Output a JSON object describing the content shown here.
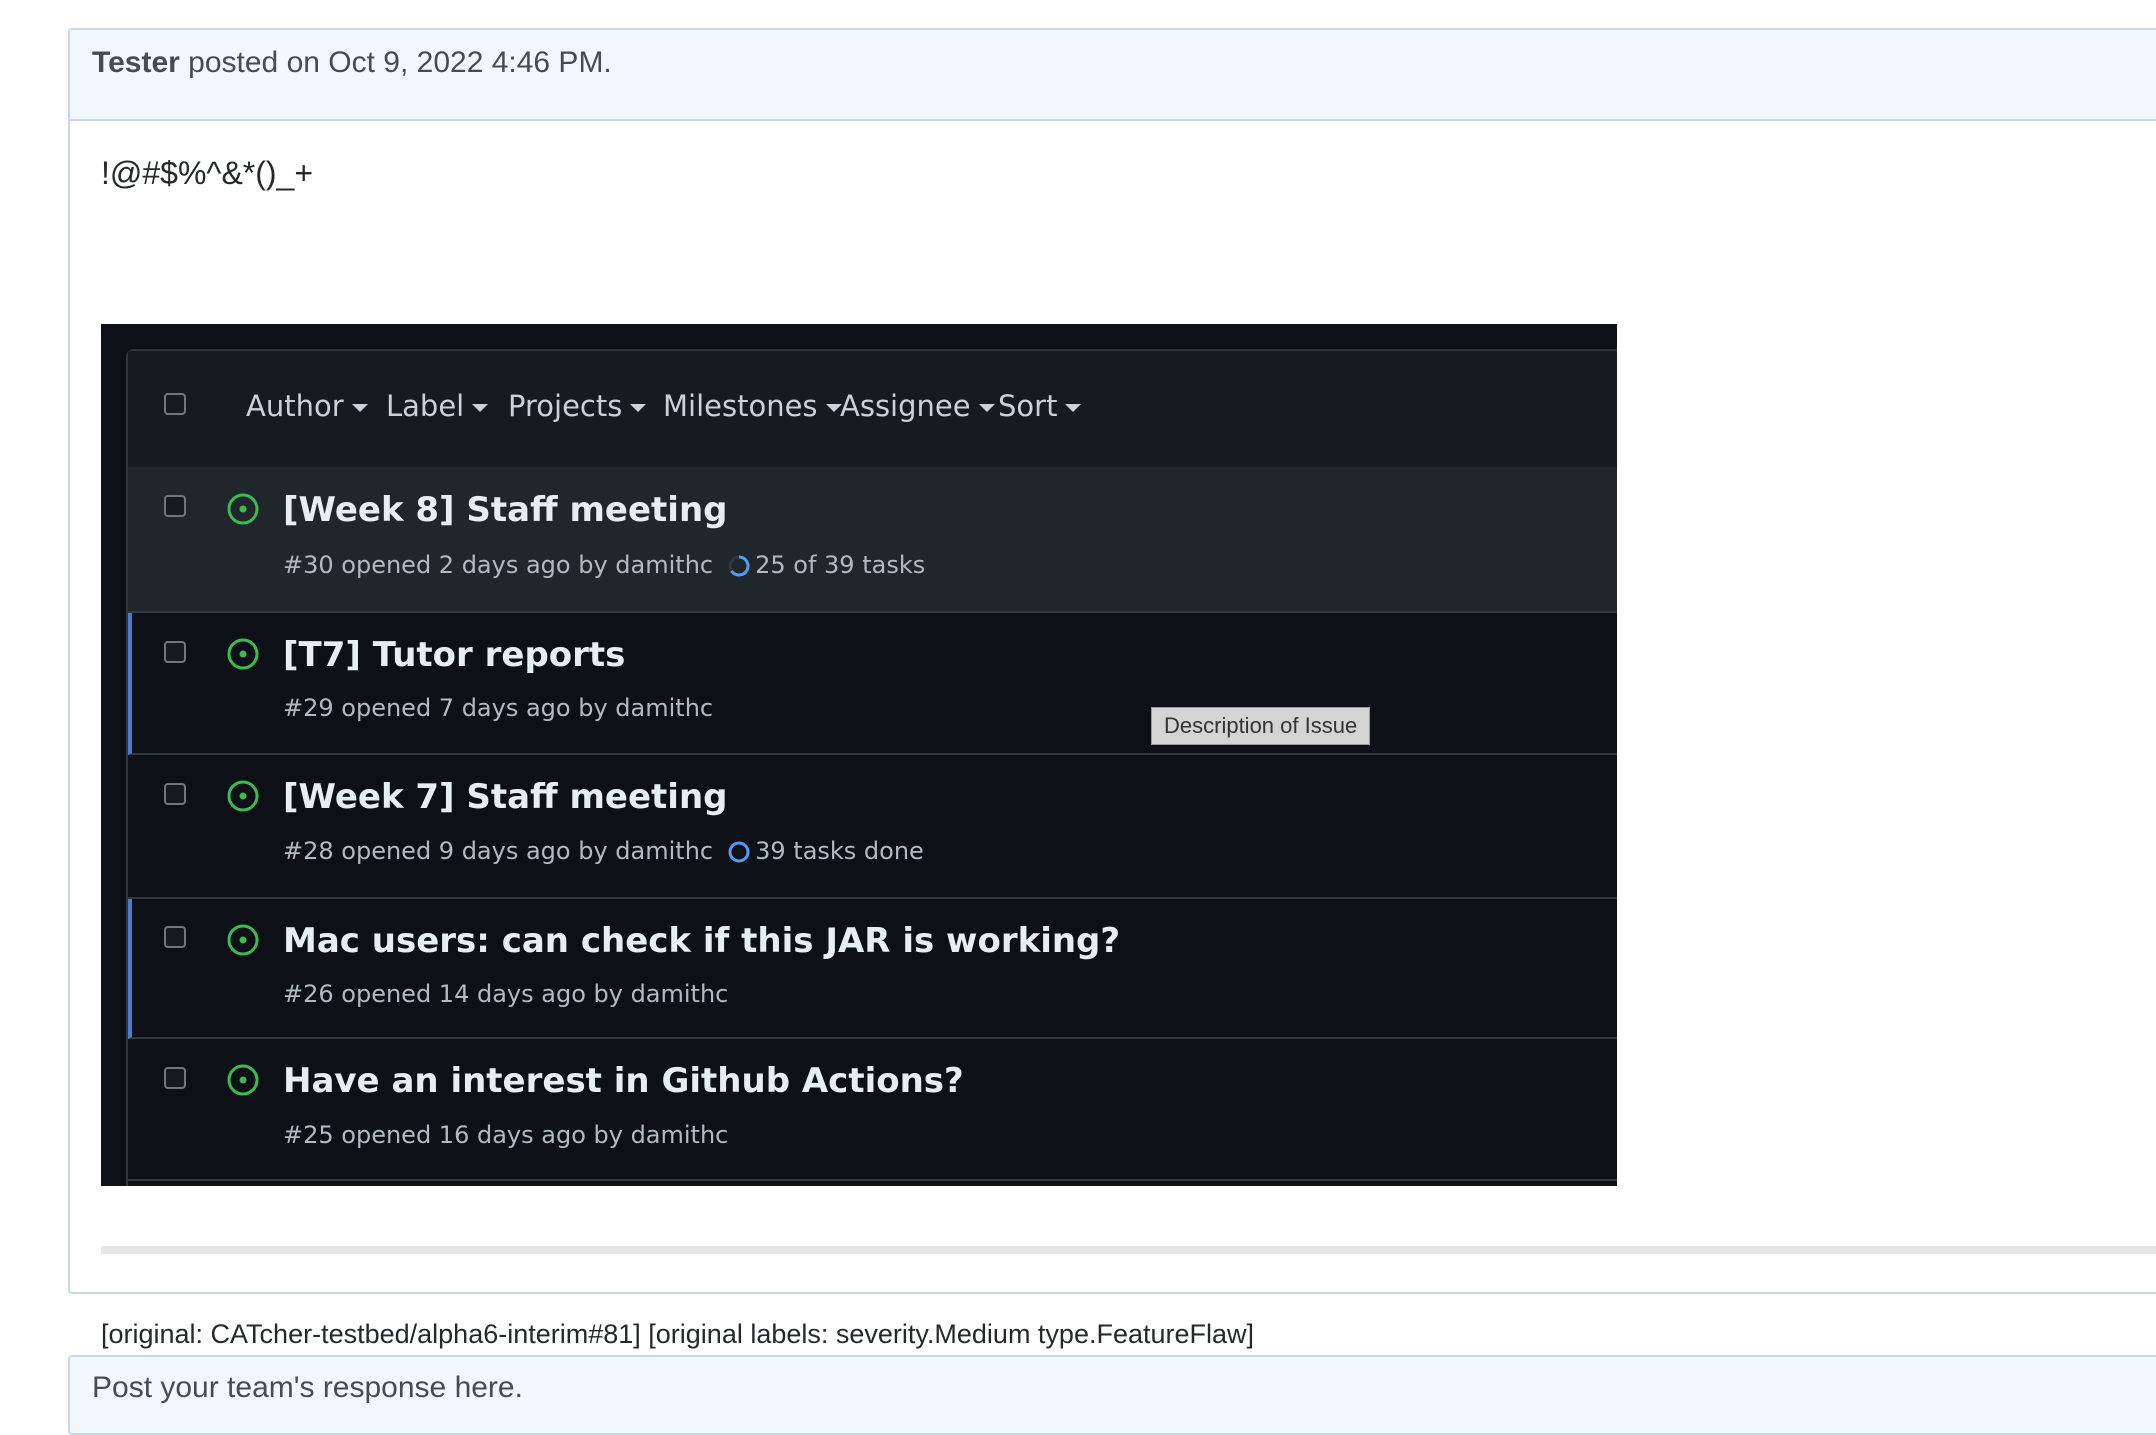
{
  "comment": {
    "author": "Tester",
    "posted_text": " posted on Oct 9, 2022 4:46 PM.",
    "body_text": "!@#$%^&*()_+",
    "original_line": "[original: CATcher-testbed/alpha6-interim#81] [original labels: severity.Medium type.FeatureFlaw]"
  },
  "screenshot": {
    "filters": [
      "Author",
      "Label",
      "Projects",
      "Milestones",
      "Assignee",
      "Sort"
    ],
    "issues": [
      {
        "title": "[Week 8] Staff meeting",
        "meta": "#30 opened 2 days ago by damithc",
        "tasks": "25 of 39 tasks",
        "task_icon": "progress-ring-icon"
      },
      {
        "title": "[T7] Tutor reports",
        "meta": "#29 opened 7 days ago by damithc",
        "tasks": "",
        "task_icon": ""
      },
      {
        "title": "[Week 7] Staff meeting",
        "meta": "#28 opened 9 days ago by damithc",
        "tasks": "39 tasks done",
        "task_icon": "complete-ring-icon"
      },
      {
        "title": "Mac users: can check if this JAR is working?",
        "meta": "#26 opened 14 days ago by damithc",
        "tasks": "",
        "task_icon": ""
      },
      {
        "title": "Have an interest in Github Actions?",
        "meta": "#25 opened 16 days ago by damithc",
        "tasks": "",
        "task_icon": ""
      }
    ],
    "tooltip": "Description of Issue",
    "colors": {
      "open_icon": "#3fb950",
      "task_ring": "#539bf5",
      "highlight_bar": "#4b7ad1"
    }
  },
  "response": {
    "placeholder": "Post your team's response here."
  }
}
